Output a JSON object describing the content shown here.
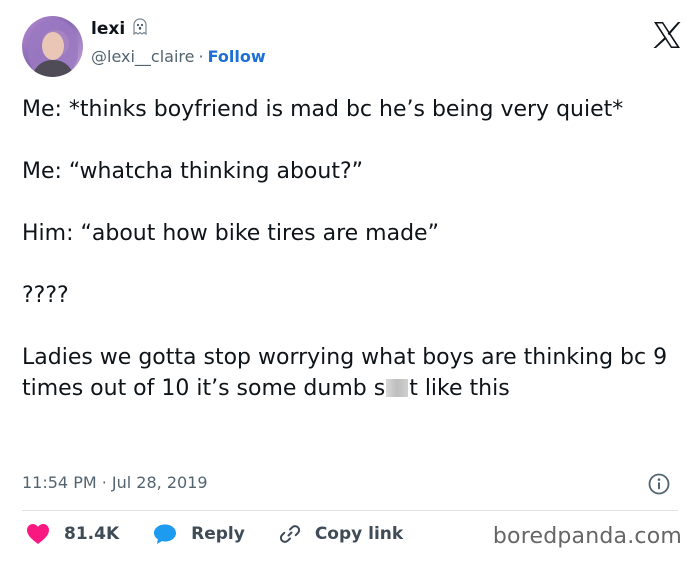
{
  "author": {
    "name": "lexi",
    "badge_icon": "ghost-icon",
    "handle": "@lexi__claire",
    "separator": "·",
    "follow_label": "Follow"
  },
  "tweet": {
    "lines": [
      "Me: *thinks boyfriend is mad bc he’s being very quiet*",
      "Me: “whatcha thinking about?”",
      "Him: “about how bike tires are made”",
      "????"
    ],
    "last_line_before": "Ladies we gotta stop worrying what boys are thinking bc 9 times out of 10 it’s some dumb s",
    "last_line_after": "t like this",
    "timestamp": "11:54 PM · Jul 28, 2019"
  },
  "actions": {
    "like_count": "81.4K",
    "reply_label": "Reply",
    "copy_link_label": "Copy link"
  },
  "watermark": "boredpanda.com",
  "colors": {
    "like": "#f91880",
    "reply": "#1d9bf0",
    "follow": "#1d6fd6",
    "muted_text": "#536471"
  }
}
